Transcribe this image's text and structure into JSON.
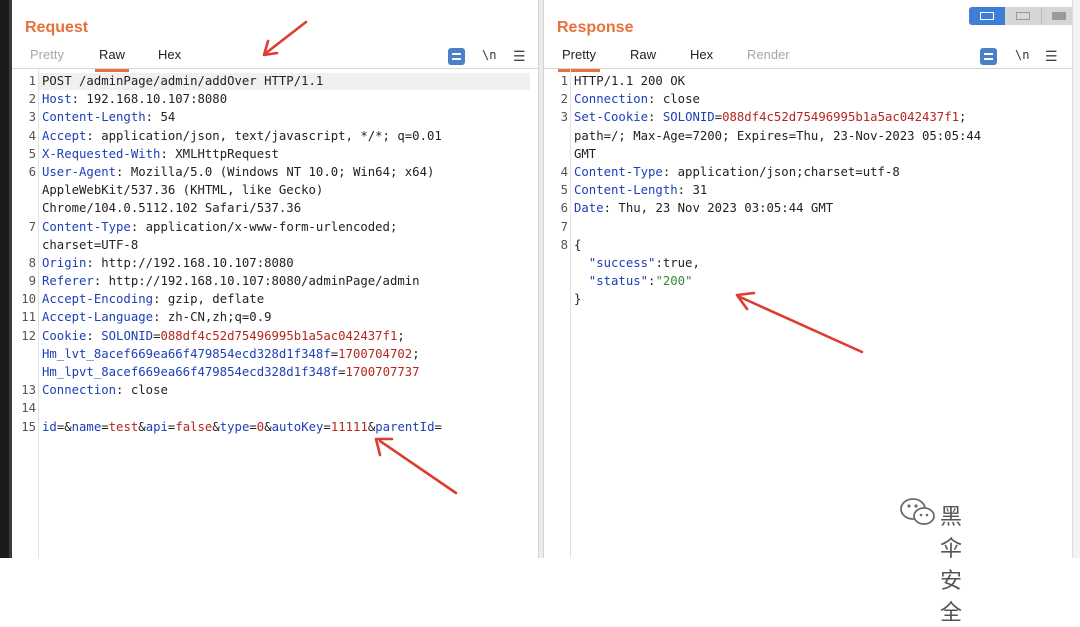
{
  "request": {
    "title": "Request",
    "tabs": [
      {
        "label": "Pretty",
        "state": "dim"
      },
      {
        "label": "Raw",
        "state": "active"
      },
      {
        "label": "Hex",
        "state": "normal"
      }
    ],
    "newline_label": "\\n",
    "lines": [
      {
        "n": "1",
        "parts": [
          {
            "t": "POST /adminPage/admin/addOver HTTP/1.1",
            "c": "v"
          }
        ]
      },
      {
        "n": "2",
        "parts": [
          {
            "t": "Host",
            "c": "k"
          },
          {
            "t": ": 192.168.10.107:8080",
            "c": "v"
          }
        ]
      },
      {
        "n": "3",
        "parts": [
          {
            "t": "Content-Length",
            "c": "k"
          },
          {
            "t": ": 54",
            "c": "v"
          }
        ]
      },
      {
        "n": "4",
        "parts": [
          {
            "t": "Accept",
            "c": "k"
          },
          {
            "t": ": application/json, text/javascript, */*; q=0.01",
            "c": "v"
          }
        ]
      },
      {
        "n": "5",
        "parts": [
          {
            "t": "X-Requested-With",
            "c": "k"
          },
          {
            "t": ": XMLHttpRequest",
            "c": "v"
          }
        ]
      },
      {
        "n": "6",
        "parts": [
          {
            "t": "User-Agent",
            "c": "k"
          },
          {
            "t": ": Mozilla/5.0 (Windows NT 10.0; Win64; x64)",
            "c": "v"
          }
        ]
      },
      {
        "n": "",
        "parts": [
          {
            "t": "AppleWebKit/537.36 (KHTML, like Gecko)",
            "c": "v"
          }
        ]
      },
      {
        "n": "",
        "parts": [
          {
            "t": "Chrome/104.0.5112.102 Safari/537.36",
            "c": "v"
          }
        ]
      },
      {
        "n": "7",
        "parts": [
          {
            "t": "Content-Type",
            "c": "k"
          },
          {
            "t": ": application/x-www-form-urlencoded;",
            "c": "v"
          }
        ]
      },
      {
        "n": "",
        "parts": [
          {
            "t": "charset=UTF-8",
            "c": "v"
          }
        ]
      },
      {
        "n": "8",
        "parts": [
          {
            "t": "Origin",
            "c": "k"
          },
          {
            "t": ": http://192.168.10.107:8080",
            "c": "v"
          }
        ]
      },
      {
        "n": "9",
        "parts": [
          {
            "t": "Referer",
            "c": "k"
          },
          {
            "t": ": http://192.168.10.107:8080/adminPage/admin",
            "c": "v"
          }
        ]
      },
      {
        "n": "10",
        "parts": [
          {
            "t": "Accept-Encoding",
            "c": "k"
          },
          {
            "t": ": gzip, deflate",
            "c": "v"
          }
        ]
      },
      {
        "n": "11",
        "parts": [
          {
            "t": "Accept-Language",
            "c": "k"
          },
          {
            "t": ": zh-CN,zh;q=0.9",
            "c": "v"
          }
        ]
      },
      {
        "n": "12",
        "parts": [
          {
            "t": "Cookie",
            "c": "k"
          },
          {
            "t": ": ",
            "c": "v"
          },
          {
            "t": "SOLONID",
            "c": "bl"
          },
          {
            "t": "=",
            "c": "v"
          },
          {
            "t": "088df4c52d75496995b1a5ac042437f1",
            "c": "rd"
          },
          {
            "t": ";",
            "c": "v"
          }
        ]
      },
      {
        "n": "",
        "parts": [
          {
            "t": "Hm_lvt_8acef669ea66f479854ecd328d1f348f",
            "c": "bl"
          },
          {
            "t": "=",
            "c": "v"
          },
          {
            "t": "1700704702",
            "c": "rd"
          },
          {
            "t": ";",
            "c": "v"
          }
        ]
      },
      {
        "n": "",
        "parts": [
          {
            "t": "Hm_lpvt_8acef669ea66f479854ecd328d1f348f",
            "c": "bl"
          },
          {
            "t": "=",
            "c": "v"
          },
          {
            "t": "1700707737",
            "c": "rd"
          }
        ]
      },
      {
        "n": "13",
        "parts": [
          {
            "t": "Connection",
            "c": "k"
          },
          {
            "t": ": close",
            "c": "v"
          }
        ]
      },
      {
        "n": "14",
        "parts": []
      },
      {
        "n": "15",
        "parts": [
          {
            "t": "id",
            "c": "bl"
          },
          {
            "t": "=&",
            "c": "v"
          },
          {
            "t": "name",
            "c": "bl"
          },
          {
            "t": "=",
            "c": "v"
          },
          {
            "t": "test",
            "c": "rd"
          },
          {
            "t": "&",
            "c": "v"
          },
          {
            "t": "api",
            "c": "bl"
          },
          {
            "t": "=",
            "c": "v"
          },
          {
            "t": "false",
            "c": "rd"
          },
          {
            "t": "&",
            "c": "v"
          },
          {
            "t": "type",
            "c": "bl"
          },
          {
            "t": "=",
            "c": "v"
          },
          {
            "t": "0",
            "c": "rd"
          },
          {
            "t": "&",
            "c": "v"
          },
          {
            "t": "autoKey",
            "c": "bl"
          },
          {
            "t": "=",
            "c": "v"
          },
          {
            "t": "11111",
            "c": "rd"
          },
          {
            "t": "&",
            "c": "v"
          },
          {
            "t": "parentId",
            "c": "bl"
          },
          {
            "t": "=",
            "c": "v"
          }
        ]
      }
    ]
  },
  "response": {
    "title": "Response",
    "tabs": [
      {
        "label": "Pretty",
        "state": "active"
      },
      {
        "label": "Raw",
        "state": "normal"
      },
      {
        "label": "Hex",
        "state": "normal"
      },
      {
        "label": "Render",
        "state": "dim"
      }
    ],
    "newline_label": "\\n",
    "lines": [
      {
        "n": "1",
        "parts": [
          {
            "t": "HTTP/1.1 200 OK",
            "c": "v"
          }
        ]
      },
      {
        "n": "2",
        "parts": [
          {
            "t": "Connection",
            "c": "k"
          },
          {
            "t": ": close",
            "c": "v"
          }
        ]
      },
      {
        "n": "3",
        "parts": [
          {
            "t": "Set-Cookie",
            "c": "k"
          },
          {
            "t": ": ",
            "c": "v"
          },
          {
            "t": "SOLONID",
            "c": "bl"
          },
          {
            "t": "=",
            "c": "v"
          },
          {
            "t": "088df4c52d75496995b1a5ac042437f1",
            "c": "rd"
          },
          {
            "t": ";",
            "c": "v"
          }
        ]
      },
      {
        "n": "",
        "parts": [
          {
            "t": "path=/; Max-Age=7200; Expires=Thu, 23-Nov-2023 05:05:44",
            "c": "v"
          }
        ]
      },
      {
        "n": "",
        "parts": [
          {
            "t": "GMT",
            "c": "v"
          }
        ]
      },
      {
        "n": "4",
        "parts": [
          {
            "t": "Content-Type",
            "c": "k"
          },
          {
            "t": ": application/json;charset=utf-8",
            "c": "v"
          }
        ]
      },
      {
        "n": "5",
        "parts": [
          {
            "t": "Content-Length",
            "c": "k"
          },
          {
            "t": ": 31",
            "c": "v"
          }
        ]
      },
      {
        "n": "6",
        "parts": [
          {
            "t": "Date",
            "c": "k"
          },
          {
            "t": ": Thu, 23 Nov 2023 03:05:44 GMT",
            "c": "v"
          }
        ]
      },
      {
        "n": "7",
        "parts": []
      },
      {
        "n": "8",
        "parts": [
          {
            "t": "{",
            "c": "v"
          }
        ]
      },
      {
        "n": "",
        "parts": [
          {
            "t": "  \"success\"",
            "c": "bl"
          },
          {
            "t": ":true,",
            "c": "v"
          }
        ]
      },
      {
        "n": "",
        "parts": [
          {
            "t": "  \"status\"",
            "c": "bl"
          },
          {
            "t": ":",
            "c": "v"
          },
          {
            "t": "\"200\"",
            "c": "gr"
          }
        ]
      },
      {
        "n": "",
        "parts": [
          {
            "t": "}",
            "c": "v"
          }
        ]
      }
    ]
  },
  "watermark": {
    "text": "黑伞安全",
    "icon": "wechat-icon"
  },
  "colors": {
    "accent": "#e8703a",
    "key": "#1d3fb8",
    "value_red": "#b2271f",
    "value_green": "#3a8a3a",
    "annotation_arrow": "#dd3d2f"
  }
}
